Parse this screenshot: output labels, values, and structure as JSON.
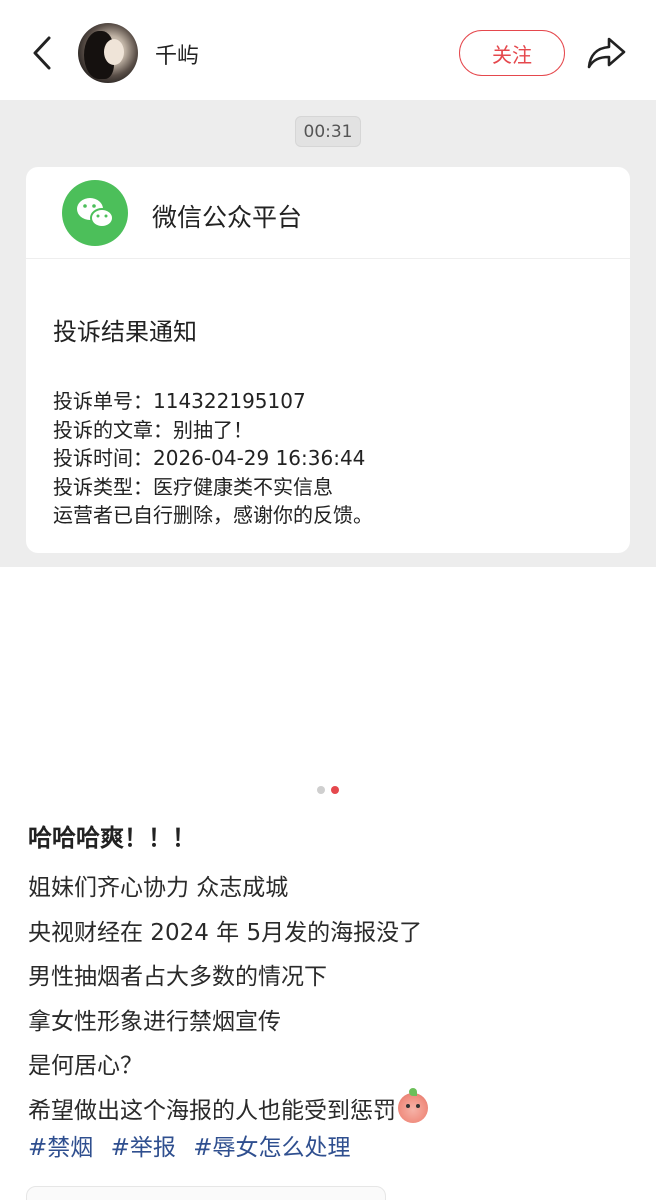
{
  "header": {
    "back_icon": "chevron-left-icon",
    "username": "千屿",
    "follow_label": "关注",
    "share_icon": "share-arrow-icon"
  },
  "screenshot": {
    "time": "00:31",
    "source_name": "微信公众平台",
    "logo_icon": "wechat-icon",
    "notice_title": "投诉结果通知",
    "lines": [
      "投诉单号：114322195107",
      "投诉的文章：别抽了！",
      "投诉时间：2026-04-29 16:36:44",
      "投诉类型：医疗健康类不实信息",
      "运营者已自行删除，感谢你的反馈。"
    ]
  },
  "carousel": {
    "total": 2,
    "active_index": 1
  },
  "post": {
    "title": "哈哈哈爽！！！",
    "lines": [
      "姐妹们齐心协力 众志成城",
      "央视财经在 2024 年 5月发的海报没了",
      "男性抽烟者占大多数的情况下",
      "拿女性形象进行禁烟宣传",
      "是何居心？",
      "希望做出这个海报的人也能受到惩罚"
    ],
    "emoji_icon": "peach-face-emoji-icon",
    "tags": [
      "#禁烟",
      "#举报",
      "#辱女怎么处理"
    ]
  },
  "colors": {
    "accent": "#e5484d",
    "tag": "#2f4f8f",
    "wechat_green": "#4cbf5a",
    "image_bg": "#ededed"
  }
}
